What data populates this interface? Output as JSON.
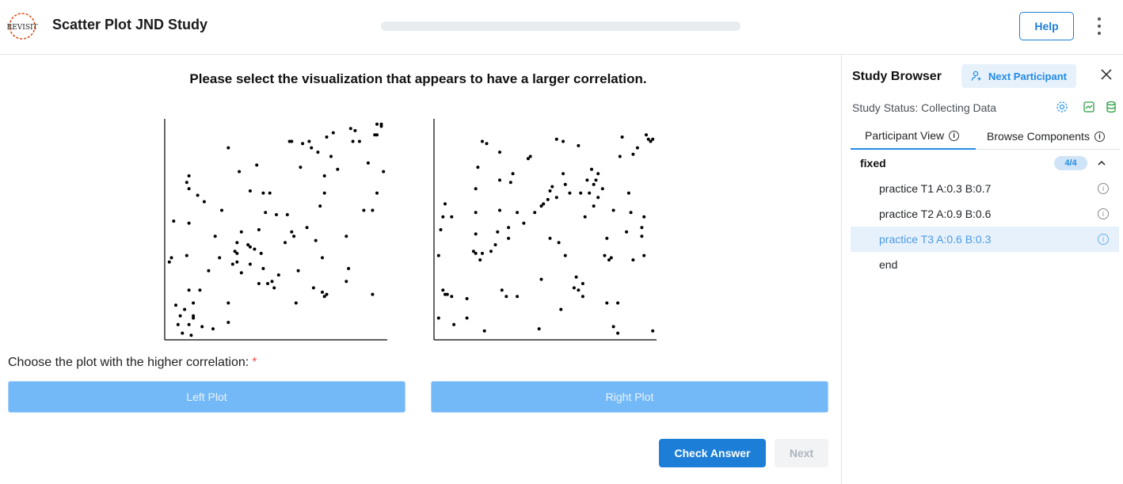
{
  "header": {
    "logo_text": "REVISIT",
    "title": "Scatter Plot JND Study",
    "progress_percent": 0,
    "help_label": "Help"
  },
  "main": {
    "question": "Please select the visualization that appears to have a larger correlation.",
    "choose_label": "Choose the plot with the higher correlation:",
    "required_mark": "*",
    "left_button": "Left Plot",
    "right_button": "Right Plot",
    "check_answer": "Check Answer",
    "next": "Next"
  },
  "chart_data": [
    {
      "type": "scatter",
      "name": "left-plot",
      "xlim": [
        0,
        1
      ],
      "ylim": [
        0,
        1
      ],
      "points": [
        [
          0.01,
          0.35
        ],
        [
          0.02,
          0.37
        ],
        [
          0.03,
          0.54
        ],
        [
          0.04,
          0.15
        ],
        [
          0.05,
          0.06
        ],
        [
          0.06,
          0.1
        ],
        [
          0.07,
          0.02
        ],
        [
          0.08,
          0.13
        ],
        [
          0.09,
          0.38
        ],
        [
          0.1,
          0.69
        ],
        [
          0.09,
          0.72
        ],
        [
          0.1,
          0.75
        ],
        [
          0.1,
          0.53
        ],
        [
          0.1,
          0.22
        ],
        [
          0.1,
          0.06
        ],
        [
          0.11,
          0.01
        ],
        [
          0.12,
          0.09
        ],
        [
          0.12,
          0.1
        ],
        [
          0.12,
          0.16
        ],
        [
          0.14,
          0.66
        ],
        [
          0.15,
          0.22
        ],
        [
          0.16,
          0.05
        ],
        [
          0.17,
          0.63
        ],
        [
          0.19,
          0.31
        ],
        [
          0.21,
          0.04
        ],
        [
          0.22,
          0.47
        ],
        [
          0.24,
          0.37
        ],
        [
          0.25,
          0.59
        ],
        [
          0.28,
          0.16
        ],
        [
          0.28,
          0.07
        ],
        [
          0.28,
          0.88
        ],
        [
          0.3,
          0.34
        ],
        [
          0.31,
          0.4
        ],
        [
          0.32,
          0.35
        ],
        [
          0.32,
          0.44
        ],
        [
          0.32,
          0.39
        ],
        [
          0.33,
          0.77
        ],
        [
          0.34,
          0.3
        ],
        [
          0.34,
          0.49
        ],
        [
          0.37,
          0.43
        ],
        [
          0.38,
          0.34
        ],
        [
          0.38,
          0.42
        ],
        [
          0.38,
          0.68
        ],
        [
          0.4,
          0.41
        ],
        [
          0.41,
          0.8
        ],
        [
          0.42,
          0.5
        ],
        [
          0.43,
          0.39
        ],
        [
          0.44,
          0.32
        ],
        [
          0.42,
          0.25
        ],
        [
          0.44,
          0.67
        ],
        [
          0.45,
          0.58
        ],
        [
          0.46,
          0.25
        ],
        [
          0.47,
          0.67
        ],
        [
          0.48,
          0.26
        ],
        [
          0.49,
          0.23
        ],
        [
          0.5,
          0.57
        ],
        [
          0.51,
          0.29
        ],
        [
          0.54,
          0.44
        ],
        [
          0.55,
          0.57
        ],
        [
          0.56,
          0.91
        ],
        [
          0.57,
          0.49
        ],
        [
          0.57,
          0.91
        ],
        [
          0.58,
          0.47
        ],
        [
          0.59,
          0.16
        ],
        [
          0.6,
          0.31
        ],
        [
          0.61,
          0.79
        ],
        [
          0.62,
          0.9
        ],
        [
          0.64,
          0.51
        ],
        [
          0.65,
          0.91
        ],
        [
          0.66,
          0.88
        ],
        [
          0.67,
          0.23
        ],
        [
          0.68,
          0.45
        ],
        [
          0.69,
          0.86
        ],
        [
          0.7,
          0.61
        ],
        [
          0.71,
          0.21
        ],
        [
          0.71,
          0.37
        ],
        [
          0.72,
          0.19
        ],
        [
          0.72,
          0.75
        ],
        [
          0.72,
          0.67
        ],
        [
          0.73,
          0.2
        ],
        [
          0.73,
          0.93
        ],
        [
          0.75,
          0.84
        ],
        [
          0.76,
          0.95
        ],
        [
          0.78,
          0.78
        ],
        [
          0.82,
          0.47
        ],
        [
          0.82,
          0.26
        ],
        [
          0.83,
          0.32
        ],
        [
          0.84,
          0.97
        ],
        [
          0.85,
          0.91
        ],
        [
          0.86,
          0.96
        ],
        [
          0.88,
          0.91
        ],
        [
          0.9,
          0.59
        ],
        [
          0.92,
          0.81
        ],
        [
          0.94,
          0.2
        ],
        [
          0.94,
          0.59
        ],
        [
          0.95,
          0.94
        ],
        [
          0.96,
          0.67
        ],
        [
          0.96,
          0.94
        ],
        [
          0.96,
          0.99
        ],
        [
          0.98,
          0.98
        ],
        [
          0.99,
          0.77
        ],
        [
          0.98,
          0.99
        ]
      ]
    },
    {
      "type": "scatter",
      "name": "right-plot",
      "xlim": [
        0,
        1
      ],
      "ylim": [
        0,
        1
      ],
      "points": [
        [
          0.01,
          0.09
        ],
        [
          0.01,
          0.38
        ],
        [
          0.02,
          0.5
        ],
        [
          0.03,
          0.56
        ],
        [
          0.03,
          0.22
        ],
        [
          0.04,
          0.62
        ],
        [
          0.05,
          0.2
        ],
        [
          0.04,
          0.2
        ],
        [
          0.07,
          0.56
        ],
        [
          0.07,
          0.19
        ],
        [
          0.08,
          0.06
        ],
        [
          0.14,
          0.18
        ],
        [
          0.14,
          0.09
        ],
        [
          0.17,
          0.4
        ],
        [
          0.18,
          0.39
        ],
        [
          0.18,
          0.48
        ],
        [
          0.18,
          0.58
        ],
        [
          0.18,
          0.69
        ],
        [
          0.19,
          0.79
        ],
        [
          0.2,
          0.36
        ],
        [
          0.21,
          0.39
        ],
        [
          0.21,
          0.91
        ],
        [
          0.22,
          0.03
        ],
        [
          0.23,
          0.9
        ],
        [
          0.25,
          0.4
        ],
        [
          0.27,
          0.43
        ],
        [
          0.28,
          0.49
        ],
        [
          0.29,
          0.59
        ],
        [
          0.29,
          0.73
        ],
        [
          0.29,
          0.86
        ],
        [
          0.3,
          0.22
        ],
        [
          0.32,
          0.19
        ],
        [
          0.33,
          0.51
        ],
        [
          0.33,
          0.46
        ],
        [
          0.34,
          0.72
        ],
        [
          0.35,
          0.76
        ],
        [
          0.37,
          0.19
        ],
        [
          0.37,
          0.58
        ],
        [
          0.4,
          0.53
        ],
        [
          0.42,
          0.83
        ],
        [
          0.43,
          0.84
        ],
        [
          0.45,
          0.58
        ],
        [
          0.47,
          0.04
        ],
        [
          0.48,
          0.27
        ],
        [
          0.48,
          0.61
        ],
        [
          0.49,
          0.62
        ],
        [
          0.51,
          0.64
        ],
        [
          0.52,
          0.68
        ],
        [
          0.53,
          0.7
        ],
        [
          0.52,
          0.46
        ],
        [
          0.55,
          0.65
        ],
        [
          0.55,
          0.92
        ],
        [
          0.56,
          0.44
        ],
        [
          0.57,
          0.13
        ],
        [
          0.58,
          0.76
        ],
        [
          0.58,
          0.91
        ],
        [
          0.59,
          0.38
        ],
        [
          0.59,
          0.71
        ],
        [
          0.61,
          0.67
        ],
        [
          0.63,
          0.23
        ],
        [
          0.64,
          0.28
        ],
        [
          0.65,
          0.22
        ],
        [
          0.65,
          0.89
        ],
        [
          0.66,
          0.67
        ],
        [
          0.67,
          0.19
        ],
        [
          0.67,
          0.25
        ],
        [
          0.68,
          0.56
        ],
        [
          0.69,
          0.73
        ],
        [
          0.7,
          0.67
        ],
        [
          0.71,
          0.78
        ],
        [
          0.72,
          0.71
        ],
        [
          0.72,
          0.61
        ],
        [
          0.73,
          0.73
        ],
        [
          0.74,
          0.76
        ],
        [
          0.74,
          0.65
        ],
        [
          0.76,
          0.69
        ],
        [
          0.77,
          0.38
        ],
        [
          0.78,
          0.46
        ],
        [
          0.78,
          0.16
        ],
        [
          0.79,
          0.36
        ],
        [
          0.8,
          0.37
        ],
        [
          0.81,
          0.59
        ],
        [
          0.81,
          0.05
        ],
        [
          0.83,
          0.02
        ],
        [
          0.83,
          0.16
        ],
        [
          0.84,
          0.84
        ],
        [
          0.85,
          0.93
        ],
        [
          0.87,
          0.49
        ],
        [
          0.88,
          0.67
        ],
        [
          0.89,
          0.58
        ],
        [
          0.9,
          0.85
        ],
        [
          0.9,
          0.36
        ],
        [
          0.92,
          0.88
        ],
        [
          0.94,
          0.47
        ],
        [
          0.94,
          0.51
        ],
        [
          0.95,
          0.56
        ],
        [
          0.95,
          0.38
        ],
        [
          0.96,
          0.94
        ],
        [
          0.97,
          0.92
        ],
        [
          0.98,
          0.91
        ],
        [
          0.99,
          0.92
        ],
        [
          0.99,
          0.03
        ]
      ]
    }
  ],
  "sidebar": {
    "title": "Study Browser",
    "next_participant": "Next Participant",
    "status": "Study Status: Collecting Data",
    "tabs": [
      "Participant View",
      "Browse Components"
    ],
    "group_name": "fixed",
    "group_count": "4/4",
    "items": [
      {
        "label": "practice T1 A:0.3 B:0.7"
      },
      {
        "label": "practice T2 A:0.9 B:0.6"
      },
      {
        "label": "practice T3 A:0.6 B:0.3"
      },
      {
        "label": "end"
      }
    ]
  },
  "colors": {
    "accent": "#1c7ed6",
    "choice_button": "#74b9f7",
    "selected_row": "#e7f1fc"
  }
}
